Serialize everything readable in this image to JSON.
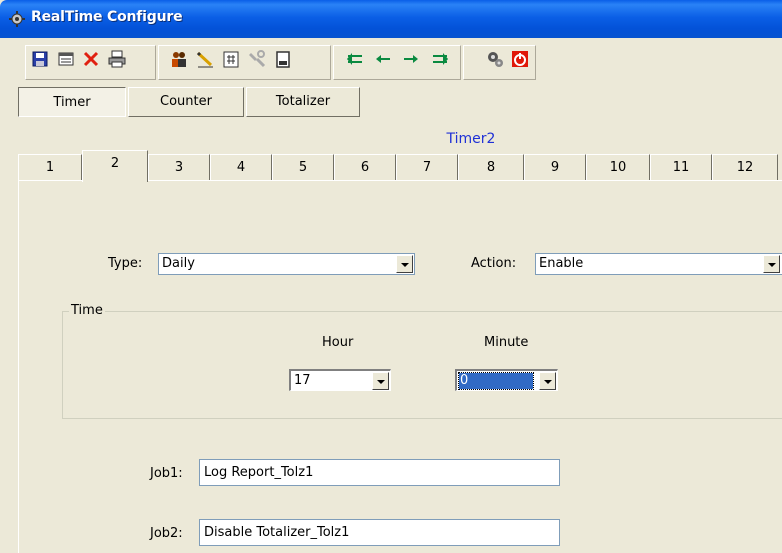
{
  "window": {
    "title": "RealTime Configure",
    "app_icon": "gear-icon"
  },
  "toolbar": {
    "buttons": [
      {
        "icon": "save-icon"
      },
      {
        "icon": "open-icon"
      },
      {
        "icon": "delete-icon"
      },
      {
        "icon": "print-icon"
      },
      {
        "icon": "users-icon"
      },
      {
        "icon": "edit-icon"
      },
      {
        "icon": "calculator-icon"
      },
      {
        "icon": "tools-icon"
      },
      {
        "icon": "notes-icon"
      },
      {
        "icon": "first-icon"
      },
      {
        "icon": "previous-icon"
      },
      {
        "icon": "next-icon"
      },
      {
        "icon": "last-icon"
      },
      {
        "icon": "settings-icon"
      },
      {
        "icon": "power-icon"
      }
    ]
  },
  "main_tabs": [
    {
      "label": "Timer",
      "active": true
    },
    {
      "label": "Counter",
      "active": false
    },
    {
      "label": "Totalizer",
      "active": false
    }
  ],
  "heading": "Timer2",
  "number_tabs": [
    "1",
    "2",
    "3",
    "4",
    "5",
    "6",
    "7",
    "8",
    "9",
    "10",
    "11",
    "12"
  ],
  "active_number_tab": "2",
  "form": {
    "type_label": "Type:",
    "type_value": "Daily",
    "action_label": "Action:",
    "action_value": "Enable",
    "time_group_label": "Time",
    "hour_label": "Hour",
    "hour_value": "17",
    "minute_label": "Minute",
    "minute_value": "0",
    "job1_label": "Job1:",
    "job1_value": "Log Report_Tolz1",
    "job2_label": "Job2:",
    "job2_value": "Disable Totalizer_Tolz1"
  },
  "colors": {
    "titlebar": "#0a5ee8",
    "heading": "#1f31d6",
    "selection": "#316ac5",
    "background": "#ece9d8"
  }
}
